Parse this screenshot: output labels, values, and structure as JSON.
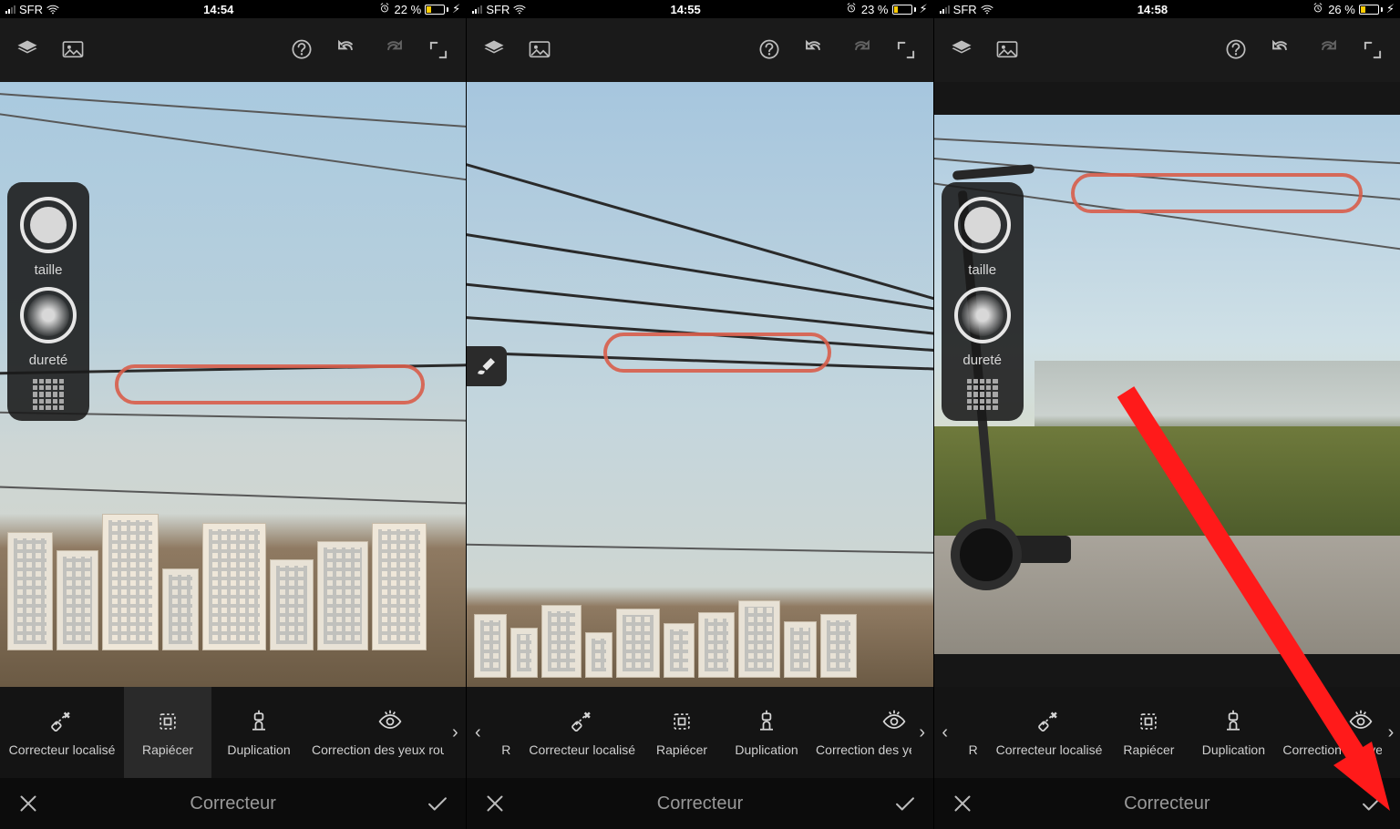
{
  "carrier": "SFR",
  "screens": [
    {
      "time": "14:54",
      "battery_text": "22 %",
      "battery_fill": 22
    },
    {
      "time": "14:55",
      "battery_text": "23 %",
      "battery_fill": 23
    },
    {
      "time": "14:58",
      "battery_text": "26 %",
      "battery_fill": 26
    }
  ],
  "side": {
    "size_label": "taille",
    "hardness_label": "dureté"
  },
  "tools": {
    "spot": "Correcteur localisé",
    "patch": "Rapiécer",
    "clone": "Duplication",
    "redeye": "Correction des yeux rouges",
    "initial_r": "R"
  },
  "footer": {
    "title": "Correcteur"
  }
}
